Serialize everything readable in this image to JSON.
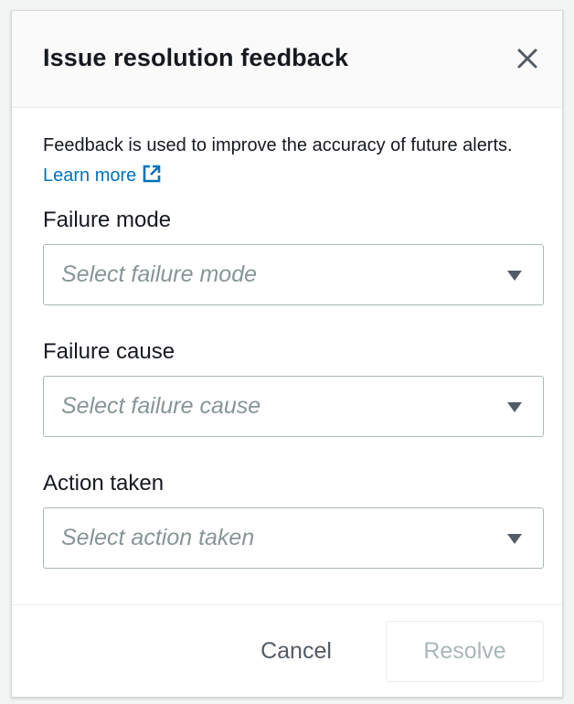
{
  "dialog": {
    "title": "Issue resolution feedback",
    "close_icon": "close-icon",
    "description": "Feedback is used to improve the accuracy of future alerts.",
    "learn_more": "Learn more",
    "learn_more_icon": "external-link-icon"
  },
  "fields": [
    {
      "label": "Failure mode",
      "placeholder": "Select failure mode",
      "icon": "caret-down-icon"
    },
    {
      "label": "Failure cause",
      "placeholder": "Select failure cause",
      "icon": "caret-down-icon"
    },
    {
      "label": "Action taken",
      "placeholder": "Select action taken",
      "icon": "caret-down-icon"
    }
  ],
  "footer": {
    "cancel_label": "Cancel",
    "resolve_label": "Resolve",
    "resolve_disabled": true
  },
  "colors": {
    "link": "#0073bb",
    "text": "#16191f",
    "placeholder": "#879596",
    "disabled": "#aab7b8",
    "header_bg": "#fafafa"
  }
}
